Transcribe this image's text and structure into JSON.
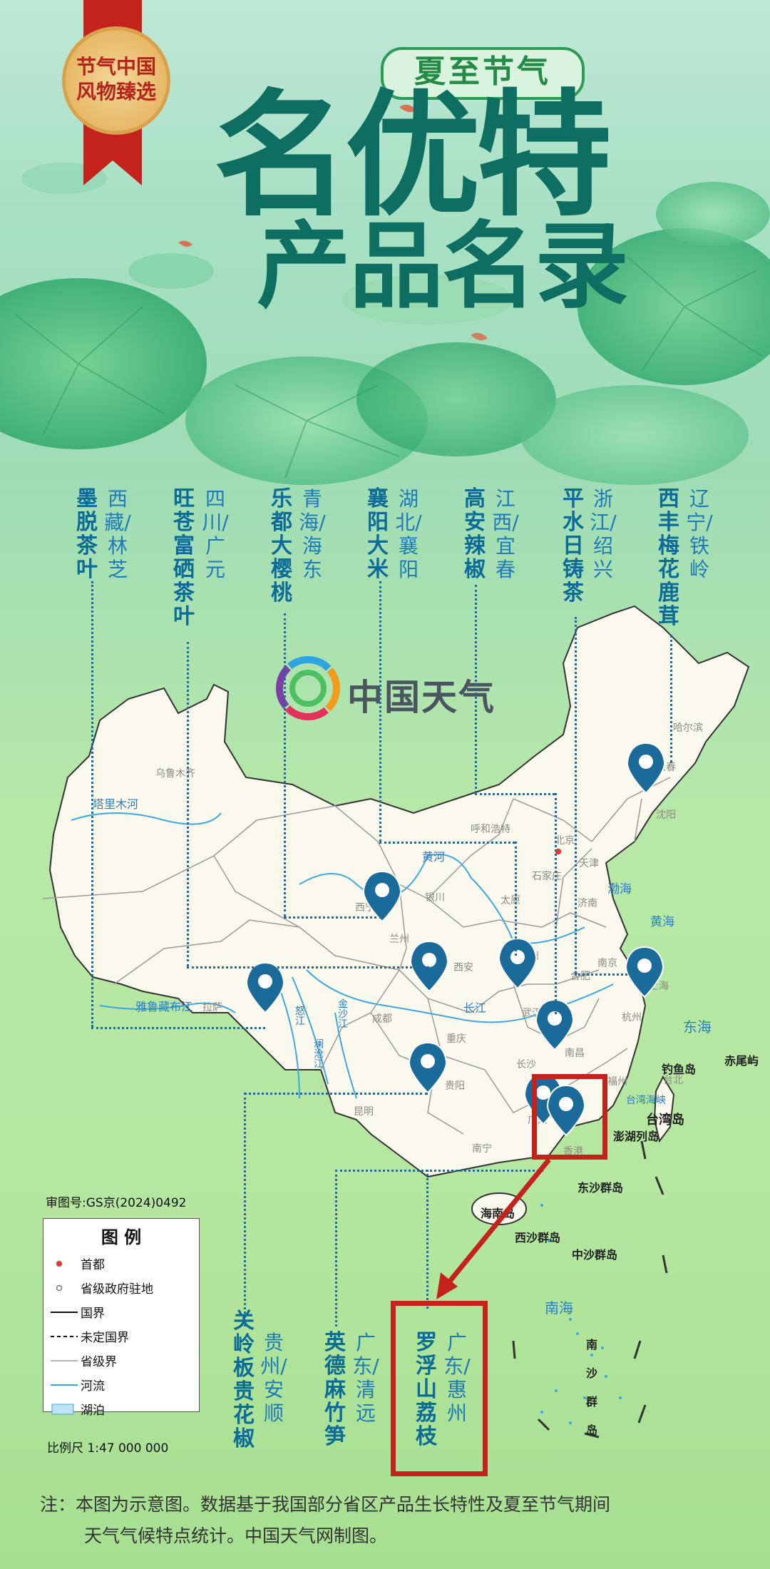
{
  "badge": {
    "text": "节气中国风物臻选"
  },
  "header": {
    "subtitle": "夏至节气",
    "title_line1": "名优特",
    "title_line2": "产品名录"
  },
  "watermark": {
    "logo_text": "中国天气"
  },
  "products": [
    {
      "id": "moutuo",
      "name": "墨脱茶叶",
      "place": "西藏/林芝"
    },
    {
      "id": "wangcang",
      "name": "旺苍富硒茶叶",
      "place": "四川/广元"
    },
    {
      "id": "ledu",
      "name": "乐都大樱桃",
      "place": "青海/海东"
    },
    {
      "id": "xiangyang",
      "name": "襄阳大米",
      "place": "湖北/襄阳"
    },
    {
      "id": "gaoan",
      "name": "高安辣椒",
      "place": "江西/宜春"
    },
    {
      "id": "pingshui",
      "name": "平水日铸茶",
      "place": "浙江/绍兴"
    },
    {
      "id": "xifeng",
      "name": "西丰梅花鹿茸",
      "place": "辽宁/铁岭"
    },
    {
      "id": "guanling",
      "name": "关岭板贵花椒",
      "place": "贵州/安顺"
    },
    {
      "id": "yingde",
      "name": "英德麻竹笋",
      "place": "广东/清远"
    },
    {
      "id": "luofushan",
      "name": "罗浮山荔枝",
      "place": "广东/惠州"
    }
  ],
  "map": {
    "cities": {
      "urumqi": "乌鲁木齐",
      "harbin": "哈尔滨",
      "changchun": "长春",
      "shenyang": "沈阳",
      "hohhot": "呼和浩特",
      "beijing": "北京",
      "tianjin": "天津",
      "shijiazhuang": "石家庄",
      "jinan": "济南",
      "taiyuan": "太原",
      "yinchuan": "银川",
      "xining": "西宁",
      "lanzhou": "兰州",
      "xian": "西安",
      "zhengzhou": "郑州",
      "hefei": "合肥",
      "nanjing": "南京",
      "shanghai": "上海",
      "hangzhou": "杭州",
      "wuhan": "武汉",
      "nanchang": "南昌",
      "changsha": "长沙",
      "chengdu": "成都",
      "chongqing": "重庆",
      "guiyang": "贵阳",
      "kunming": "昆明",
      "nanning": "南宁",
      "guangzhou": "广州",
      "fuzhou": "福州",
      "taipei": "台北",
      "lhasa": "拉萨",
      "xianggang": "香港"
    },
    "rivers": {
      "tarim": "塔里木河",
      "yellow": "黄河",
      "yangtze": "长江",
      "yarlung": "雅鲁藏布江",
      "lancang": "澜沧江",
      "jinsha": "金沙江",
      "nu": "怒江"
    },
    "seas": {
      "bohai": "渤海",
      "yellow_sea": "黄海",
      "east_sea": "东海",
      "south_sea": "南海",
      "taiwan_strait": "台湾海峡"
    },
    "islands": {
      "diaoyu": "钓鱼岛",
      "chiwei": "赤尾屿",
      "taiwan": "台湾岛",
      "penghu": "澎湖列岛",
      "dongsha": "东沙群岛",
      "hainan": "海南岛",
      "xisha": "西沙群岛",
      "zhongsha": "中沙群岛",
      "nansha": "南沙群岛"
    },
    "approval_no": "审图号:GS京(2024)0492"
  },
  "legend": {
    "title": "图 例",
    "capital": "首都",
    "provincial_seat": "省级政府驻地",
    "national_border": "国界",
    "undetermined_border": "未定国界",
    "provincial_border": "省级界",
    "river": "河流",
    "lake": "湖泊",
    "scale": "比例尺 1:47 000 000"
  },
  "footer": {
    "note_line1": "注：本图为示意图。数据基于我国部分省区产品生长特性及夏至节气期间",
    "note_line2": "天气气候特点统计。中国天气网制图。"
  },
  "colors": {
    "title": "#0f6e62",
    "accent_red": "#c4231b",
    "pin": "#1a6b9a",
    "product_name": "#0c6b97"
  }
}
